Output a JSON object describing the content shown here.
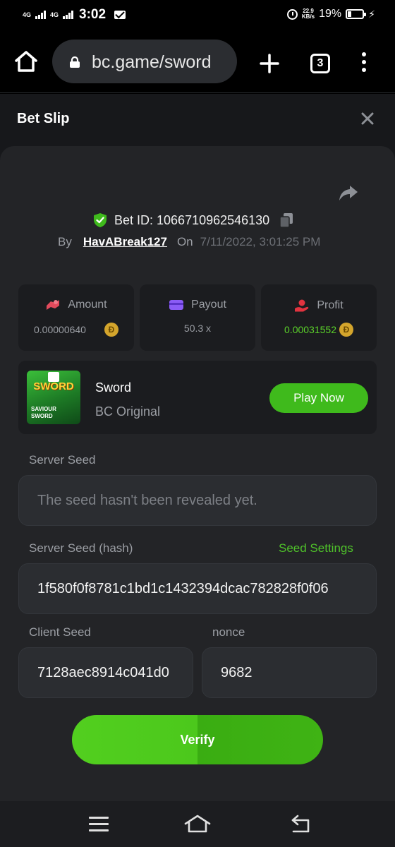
{
  "status_bar": {
    "network_1": "4G",
    "network_2": "4G",
    "time": "3:02",
    "speed_value": "22.9",
    "speed_unit": "KB/s",
    "battery": "19%"
  },
  "browser": {
    "url": "bc.game/sword",
    "tab_count": "3"
  },
  "bet_slip": {
    "title": "Bet Slip",
    "bet_id": "Bet ID: 1066710962546130",
    "by_label": "By",
    "username": "HavABreak127",
    "on_label": "On",
    "date": "7/11/2022, 3:01:25 PM"
  },
  "stats": {
    "amount_label": "Amount",
    "amount_value": "0.00000640",
    "payout_label": "Payout",
    "payout_value": "50.3 x",
    "profit_label": "Profit",
    "profit_value": "0.00031552",
    "coin_symbol": "Đ"
  },
  "game": {
    "name": "Sword",
    "subtitle": "BC Original",
    "play_label": "Play Now",
    "thumb_title": "SWORD",
    "thumb_subtitle_1": "SAVIOUR",
    "thumb_subtitle_2": "SWORD"
  },
  "seeds": {
    "server_seed_label": "Server Seed",
    "server_seed_placeholder": "The seed hasn't been revealed yet.",
    "server_hash_label": "Server Seed (hash)",
    "seed_settings_label": "Seed Settings",
    "server_hash_value": "1f580f0f8781c1bd1c1432394dcac782828f0f06",
    "client_seed_label": "Client Seed",
    "client_seed_value": "7128aec8914c041d0",
    "nonce_label": "nonce",
    "nonce_value": "9682"
  },
  "verify_label": "Verify",
  "colors": {
    "accent_green": "#3fba1c",
    "panel_bg": "#232427",
    "page_bg": "#17181b"
  }
}
